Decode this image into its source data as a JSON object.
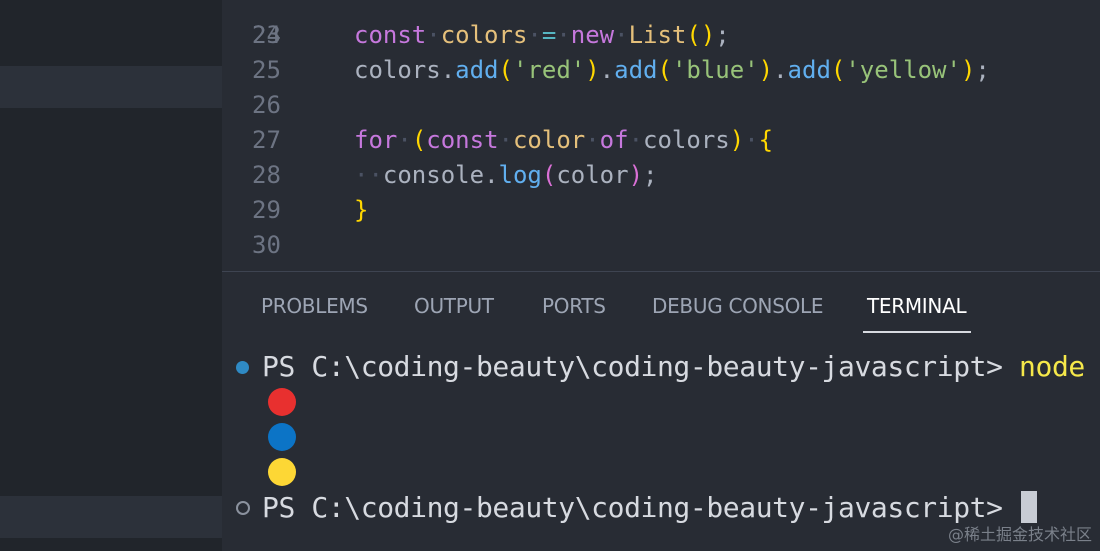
{
  "editor": {
    "partial_top_line_number": "23",
    "lines": [
      {
        "num": "24",
        "tokens": [
          {
            "t": "const",
            "c": "kw"
          },
          {
            "t": " ",
            "c": "ws"
          },
          {
            "t": "colors",
            "c": "var"
          },
          {
            "t": " ",
            "c": "ws"
          },
          {
            "t": "=",
            "c": "op"
          },
          {
            "t": " ",
            "c": "ws"
          },
          {
            "t": "new",
            "c": "kw"
          },
          {
            "t": " ",
            "c": "ws"
          },
          {
            "t": "List",
            "c": "cls"
          },
          {
            "t": "()",
            "c": "b1"
          },
          {
            "t": ";",
            "c": "plain"
          }
        ]
      },
      {
        "num": "25",
        "tokens": [
          {
            "t": "colors",
            "c": "plain"
          },
          {
            "t": ".",
            "c": "plain"
          },
          {
            "t": "add",
            "c": "fn"
          },
          {
            "t": "(",
            "c": "b1"
          },
          {
            "t": "'red'",
            "c": "str"
          },
          {
            "t": ")",
            "c": "b1"
          },
          {
            "t": ".",
            "c": "plain"
          },
          {
            "t": "add",
            "c": "fn"
          },
          {
            "t": "(",
            "c": "b1"
          },
          {
            "t": "'blue'",
            "c": "str"
          },
          {
            "t": ")",
            "c": "b1"
          },
          {
            "t": ".",
            "c": "plain"
          },
          {
            "t": "add",
            "c": "fn"
          },
          {
            "t": "(",
            "c": "b1"
          },
          {
            "t": "'yellow'",
            "c": "str"
          },
          {
            "t": ")",
            "c": "b1"
          },
          {
            "t": ";",
            "c": "plain"
          }
        ]
      },
      {
        "num": "26",
        "tokens": []
      },
      {
        "num": "27",
        "tokens": [
          {
            "t": "for",
            "c": "kw"
          },
          {
            "t": " ",
            "c": "ws"
          },
          {
            "t": "(",
            "c": "b1"
          },
          {
            "t": "const",
            "c": "kw"
          },
          {
            "t": " ",
            "c": "ws"
          },
          {
            "t": "color",
            "c": "var"
          },
          {
            "t": " ",
            "c": "ws"
          },
          {
            "t": "of",
            "c": "kw"
          },
          {
            "t": " ",
            "c": "ws"
          },
          {
            "t": "colors",
            "c": "plain"
          },
          {
            "t": ")",
            "c": "b1"
          },
          {
            "t": " ",
            "c": "ws"
          },
          {
            "t": "{",
            "c": "b1"
          }
        ]
      },
      {
        "num": "28",
        "tokens": [
          {
            "t": "··",
            "c": "guide"
          },
          {
            "t": "console",
            "c": "plain"
          },
          {
            "t": ".",
            "c": "plain"
          },
          {
            "t": "log",
            "c": "fn"
          },
          {
            "t": "(",
            "c": "b2"
          },
          {
            "t": "color",
            "c": "plain"
          },
          {
            "t": ")",
            "c": "b2"
          },
          {
            "t": ";",
            "c": "plain"
          }
        ]
      },
      {
        "num": "29",
        "tokens": [
          {
            "t": "}",
            "c": "b1"
          }
        ]
      },
      {
        "num": "30",
        "tokens": []
      }
    ]
  },
  "panel": {
    "tabs": [
      {
        "label": "PROBLEMS",
        "active": false
      },
      {
        "label": "OUTPUT",
        "active": false
      },
      {
        "label": "PORTS",
        "active": false
      },
      {
        "label": "DEBUG CONSOLE",
        "active": false
      },
      {
        "label": "TERMINAL",
        "active": true
      }
    ]
  },
  "terminal": {
    "prompt1": "PS C:\\coding-beauty\\coding-beauty-javascript> ",
    "command1": "node",
    "output_circles": [
      {
        "color": "#e8302f",
        "meaning": "red"
      },
      {
        "color": "#0c74c6",
        "meaning": "blue"
      },
      {
        "color": "#fdd735",
        "meaning": "yellow"
      }
    ],
    "prompt2": "PS C:\\coding-beauty\\coding-beauty-javascript> "
  },
  "watermark": "@稀土掘金技术社区",
  "colors": {
    "editor_bg": "#282c34",
    "sidebar_bg": "#21252b",
    "keyword": "#c678dd",
    "string": "#98c379",
    "function": "#61afef",
    "bracket": "#ffd700",
    "command": "#f5e84a",
    "dot_success": "#2f8ac4"
  }
}
